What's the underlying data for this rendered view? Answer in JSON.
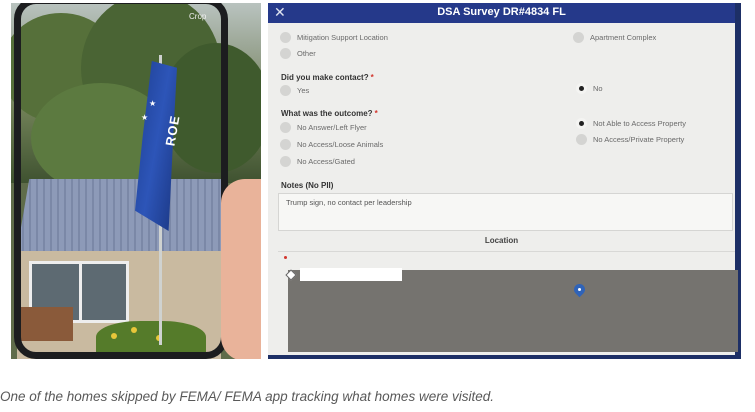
{
  "left_photo": {
    "crop_label": "Crop",
    "flag_text": "ROE"
  },
  "survey": {
    "title": "DSA Survey DR#4834 FL",
    "close_icon": "close-icon",
    "location_type_options": [
      {
        "label": "Mitigation Support Location",
        "selected": false
      },
      {
        "label": "Other",
        "selected": false
      },
      {
        "label": "Apartment Complex",
        "selected": false
      }
    ],
    "contact_question": {
      "label": "Did you make contact?",
      "required_mark": "*",
      "options": [
        {
          "label": "Yes",
          "selected": false
        },
        {
          "label": "No",
          "selected": true
        }
      ]
    },
    "outcome_question": {
      "label": "What was the outcome?",
      "required_mark": "*",
      "options": [
        {
          "label": "No Answer/Left Flyer",
          "selected": false
        },
        {
          "label": "No Access/Loose Animals",
          "selected": false
        },
        {
          "label": "No Access/Gated",
          "selected": false
        },
        {
          "label": "Not Able to Access Property",
          "selected": true
        },
        {
          "label": "No Access/Private Property",
          "selected": false
        }
      ]
    },
    "notes": {
      "label": "Notes (No PII)",
      "value": "Trump sign, no contact per leadership"
    },
    "location": {
      "label": "Location"
    },
    "colors": {
      "title_bar": "#25398a",
      "required": "#d2352d",
      "map_pin": "#2f63b8"
    }
  },
  "caption": "One of the homes skipped by FEMA/ FEMA app tracking what homes were visited."
}
